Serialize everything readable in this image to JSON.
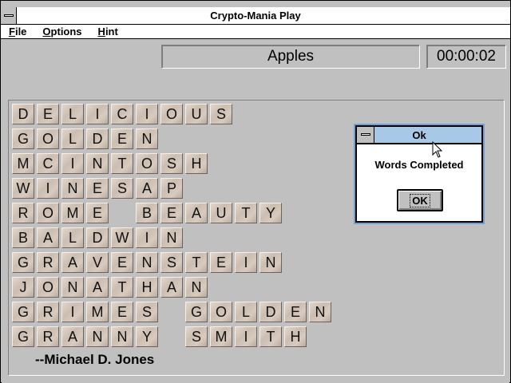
{
  "window": {
    "title": "Crypto-Mania Play"
  },
  "menu": [
    {
      "underline": "F",
      "rest": "ile"
    },
    {
      "underline": "O",
      "rest": "ptions"
    },
    {
      "underline": "H",
      "rest": "int"
    }
  ],
  "category": "Apples",
  "timer": "00:00:02",
  "puzzle": {
    "rows": [
      [
        "DELICIOUS"
      ],
      [
        "GOLDEN"
      ],
      [
        "MCINTOSH"
      ],
      [
        "WINESAP"
      ],
      [
        "ROME",
        "BEAUTY"
      ],
      [
        "BALDWIN"
      ],
      [
        "GRAVENSTEIN"
      ],
      [
        "JONATHAN"
      ],
      [
        "GRIMES",
        "GOLDEN"
      ],
      [
        "GRANNY",
        "SMITH"
      ]
    ],
    "author": "--Michael D. Jones"
  },
  "dialog": {
    "title": "Ok",
    "message": "Words Completed",
    "ok_label": "OK"
  }
}
